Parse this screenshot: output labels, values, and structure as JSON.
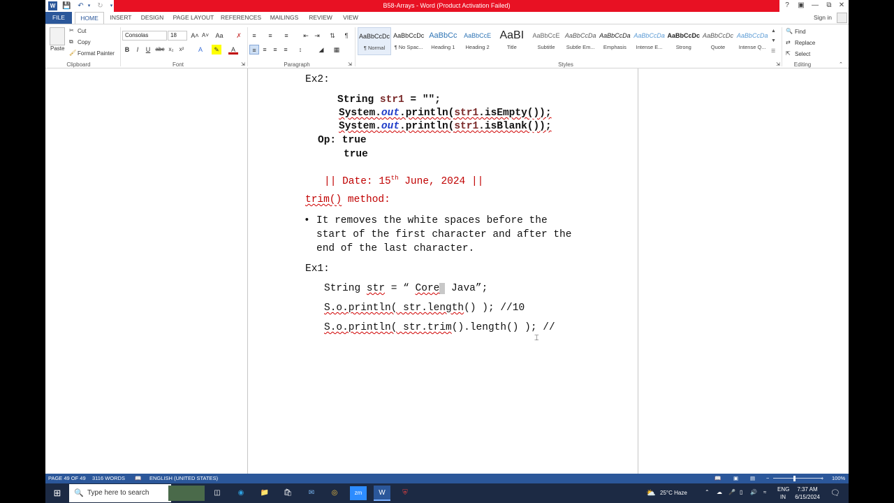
{
  "window": {
    "title": "B58-Arrays - Word (Product Activation Failed)",
    "help": "?",
    "signin": "Sign in"
  },
  "tabs": [
    "FILE",
    "HOME",
    "INSERT",
    "DESIGN",
    "PAGE LAYOUT",
    "REFERENCES",
    "MAILINGS",
    "REVIEW",
    "VIEW"
  ],
  "ribbon": {
    "clipboard": {
      "paste": "Paste",
      "cut": "Cut",
      "copy": "Copy",
      "format_painter": "Format Painter",
      "label": "Clipboard"
    },
    "font": {
      "name": "Consolas",
      "size": "18",
      "label": "Font"
    },
    "paragraph": {
      "label": "Paragraph"
    },
    "styles": {
      "label": "Styles",
      "items": [
        {
          "preview": "AaBbCcDc",
          "name": "¶ Normal"
        },
        {
          "preview": "AaBbCcDc",
          "name": "¶ No Spac..."
        },
        {
          "preview": "AaBbCc",
          "name": "Heading 1"
        },
        {
          "preview": "AaBbCcE",
          "name": "Heading 2"
        },
        {
          "preview": "AaBI",
          "name": "Title"
        },
        {
          "preview": "AaBbCcE",
          "name": "Subtitle"
        },
        {
          "preview": "AaBbCcDa",
          "name": "Subtle Em..."
        },
        {
          "preview": "AaBbCcDa",
          "name": "Emphasis"
        },
        {
          "preview": "AaBbCcDa",
          "name": "Intense E..."
        },
        {
          "preview": "AaBbCcDc",
          "name": "Strong"
        },
        {
          "preview": "AaBbCcDc",
          "name": "Quote"
        },
        {
          "preview": "AaBbCcDa",
          "name": "Intense Q..."
        }
      ]
    },
    "editing": {
      "find": "Find",
      "replace": "Replace",
      "select": "Select",
      "label": "Editing"
    }
  },
  "document": {
    "ex2_heading": "Ex2:",
    "code1": {
      "kw": "String ",
      "var": "str1",
      "rest": " = \"\";"
    },
    "code2": {
      "a": "System.",
      "b": "out",
      "c": ".println(",
      "d": "str1",
      ".e": "",
      "e": ".isEmpty());"
    },
    "code3": {
      "a": "System.",
      "b": "out",
      "c": ".println(",
      "d": "str1",
      "e": ".isBlank());"
    },
    "op_label": "Op: true",
    "op_value2": "true",
    "date_pre": "|| Date: 15",
    "date_sup": "th",
    "date_post": " June, 2024 ||",
    "trim_heading_a": "trim()",
    "trim_heading_b": " method:",
    "bullet": "•",
    "bullet_line1": "It removes the white spaces before the",
    "bullet_line2": "start of the first character and after the",
    "bullet_line3": "end of the last character.",
    "ex1_heading": "Ex1:",
    "ex1_line1_a": "String ",
    "ex1_line1_b": "str",
    "ex1_line1_c": " = “ ",
    "ex1_line1_d": "Core",
    "ex1_line1_e": " Java”;",
    "ex1_line2_a": "S.o.println(",
    "ex1_line2_b": " str.length",
    "ex1_line2_c": "() ); //10",
    "ex1_line3_a": "S.o.println(",
    "ex1_line3_b": " str.trim",
    "ex1_line3_c": "().length() ); //"
  },
  "statusbar": {
    "page": "PAGE 49 OF 49",
    "words": "3116 WORDS",
    "language": "ENGLISH (UNITED STATES)",
    "zoom": "100%"
  },
  "taskbar": {
    "search_placeholder": "Type here to search",
    "weather": "25°C  Haze",
    "lang_line1": "ENG",
    "lang_line2": "IN",
    "time": "7:37 AM",
    "date": "6/15/2024"
  },
  "colors": {
    "accent": "#2b579a",
    "titlebar_red": "#e81123",
    "doc_red": "#c00000"
  }
}
